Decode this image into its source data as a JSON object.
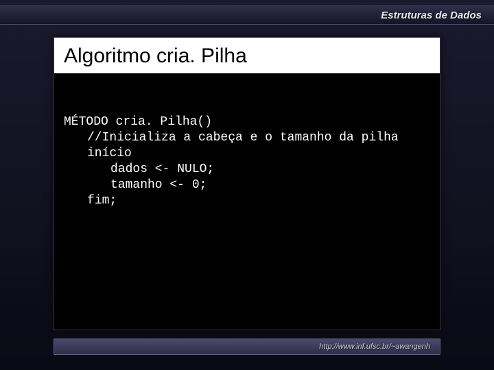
{
  "header": {
    "title": "Estruturas de Dados"
  },
  "slide": {
    "title": "Algoritmo cria. Pilha"
  },
  "code": {
    "line1": "MÉTODO cria. Pilha()",
    "line2": "//Inicializa a cabeça e o tamanho da pilha",
    "line3": "início",
    "line4": "dados <- NULO;",
    "line5": "tamanho <- 0;",
    "line6": "fim;"
  },
  "footer": {
    "url": "http://www.inf.ufsc.br/~awangenh"
  }
}
